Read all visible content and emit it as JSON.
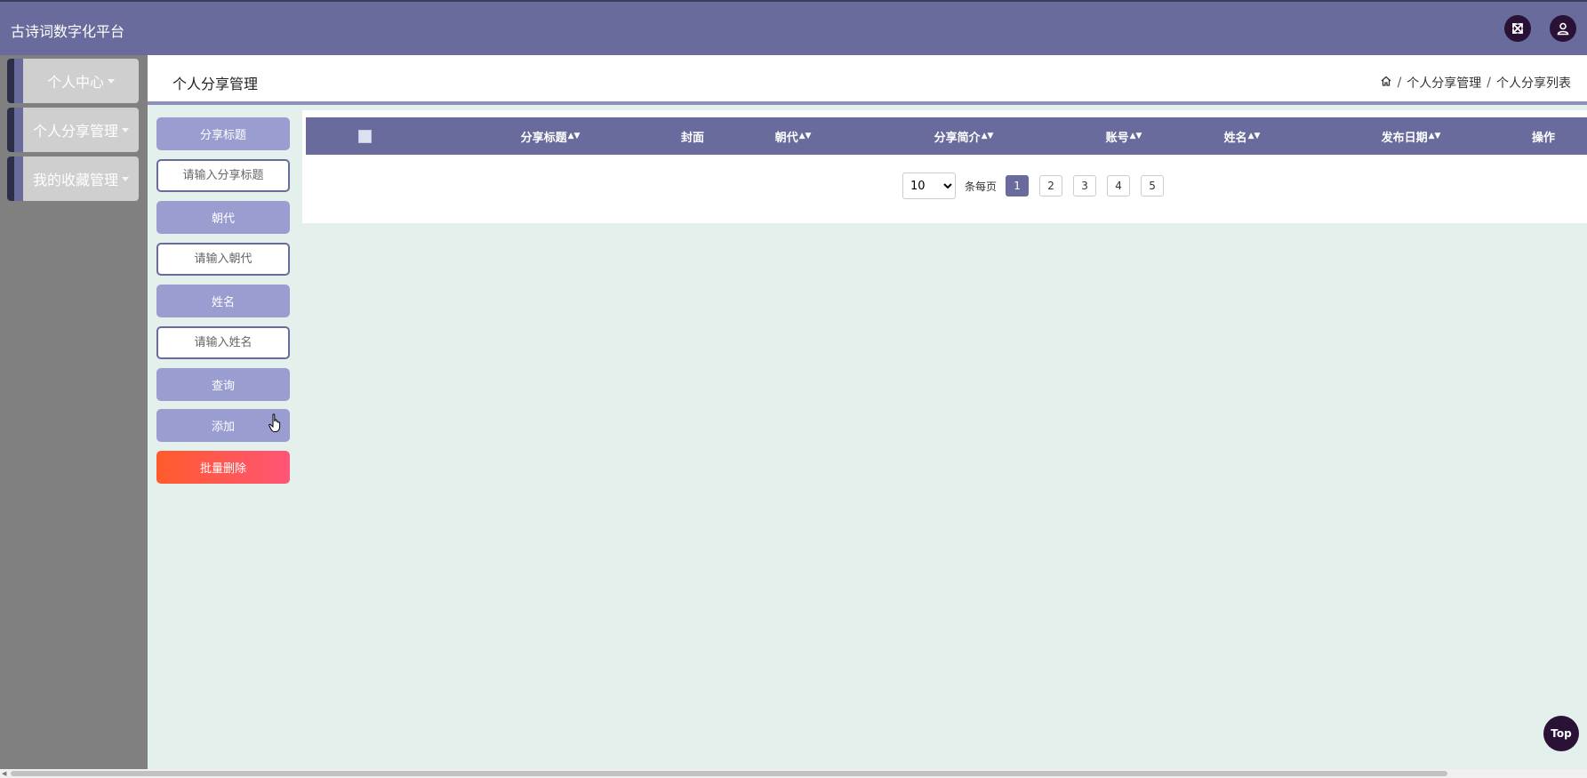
{
  "app": {
    "title": "古诗词数字化平台"
  },
  "topbar": {
    "icons": [
      "fullscreen-icon",
      "user-icon"
    ]
  },
  "sidebar": {
    "items": [
      {
        "label": "个人中心"
      },
      {
        "label": "个人分享管理"
      },
      {
        "label": "我的收藏管理"
      }
    ]
  },
  "header": {
    "title": "个人分享管理",
    "breadcrumb": [
      "个人分享管理",
      "个人分享列表"
    ]
  },
  "filters": {
    "share_title_label": "分享标题",
    "share_title_placeholder": "请输入分享标题",
    "dynasty_label": "朝代",
    "dynasty_placeholder": "请输入朝代",
    "name_label": "姓名",
    "name_placeholder": "请输入姓名",
    "query_label": "查询",
    "add_label": "添加",
    "batch_delete_label": "批量删除"
  },
  "table": {
    "columns": [
      "分享标题",
      "封面",
      "朝代",
      "分享简介",
      "账号",
      "姓名",
      "发布日期",
      "操作"
    ],
    "rows": []
  },
  "pagination": {
    "page_size": "10",
    "page_size_options": [
      "10"
    ],
    "per_page_label": "条每页",
    "pages": [
      "1",
      "2",
      "3",
      "4",
      "5"
    ],
    "current": "1"
  },
  "back_to_top": "Top",
  "colors": {
    "primary": "#686b9c",
    "filter_button": "#9a9dcf",
    "danger": "#ff5a2c",
    "icon_bg": "#2a1236",
    "content_bg": "#e4f0eb",
    "sidebar_bg": "#808080"
  }
}
